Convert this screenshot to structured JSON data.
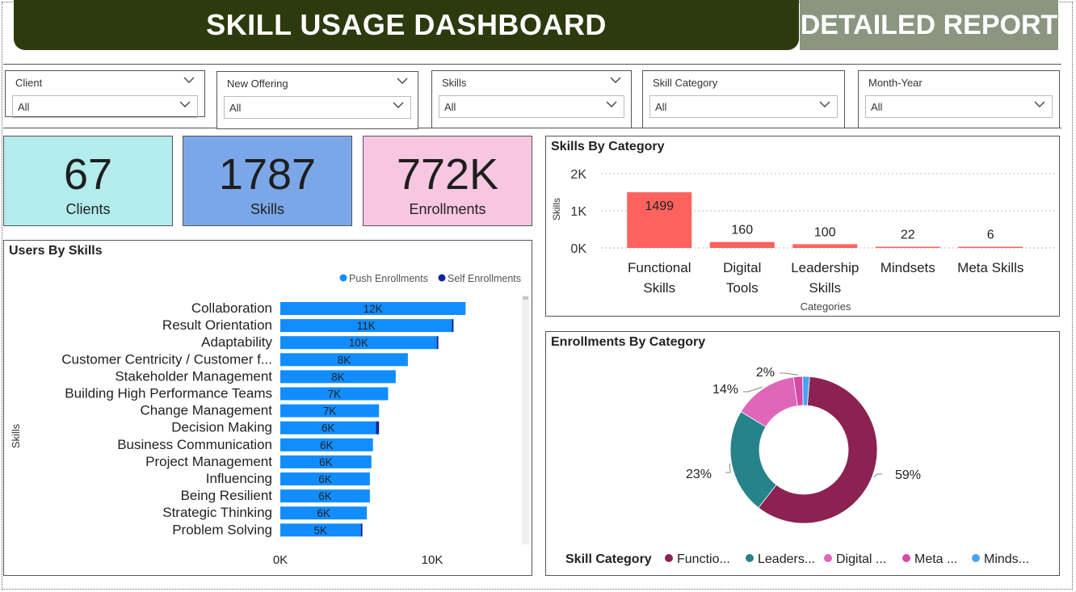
{
  "header": {
    "title": "SKILL USAGE DASHBOARD",
    "report_button": "DETAILED REPORT"
  },
  "filters": [
    {
      "label": "Client",
      "value": "All"
    },
    {
      "label": "New Offering",
      "value": "All"
    },
    {
      "label": "Skills",
      "value": "All"
    },
    {
      "label": "Skill Category",
      "value": "All"
    },
    {
      "label": "Month-Year",
      "value": "All"
    }
  ],
  "kpis": [
    {
      "value": "67",
      "caption": "Clients",
      "color": "#b3ecec"
    },
    {
      "value": "1787",
      "caption": "Skills",
      "color": "#7ba7e8"
    },
    {
      "value": "772K",
      "caption": "Enrollments",
      "color": "#f7c6e0"
    }
  ],
  "colors": {
    "title_bg": "#2d3a0e",
    "report_bg": "#8c9580",
    "push": "#118dff",
    "self": "#12239e",
    "category_bar": "#fd625e"
  },
  "chart_data": [
    {
      "type": "bar",
      "orientation": "horizontal",
      "title": "Users By Skills",
      "ylabel": "Skills",
      "legend": "top-right",
      "series": [
        {
          "name": "Push Enrollments",
          "values": [
            12200,
            11300,
            10300,
            8400,
            7600,
            7100,
            6500,
            6300,
            6100,
            6000,
            5900,
            5900,
            5700,
            5300
          ]
        },
        {
          "name": "Self Enrollments",
          "values": [
            0,
            100,
            100,
            0,
            0,
            0,
            0,
            200,
            0,
            0,
            0,
            0,
            0,
            100
          ]
        }
      ],
      "categories": [
        "Collaboration",
        "Result Orientation",
        "Adaptability",
        "Customer Centricity / Customer f...",
        "Stakeholder Management",
        "Building High Performance Teams",
        "Change Management",
        "Decision Making",
        "Business Communication",
        "Project Management",
        "Influencing",
        "Being Resilient",
        "Strategic Thinking",
        "Problem Solving"
      ],
      "data_labels": [
        "12K",
        "11K",
        "10K",
        "8K",
        "8K",
        "7K",
        "7K",
        "6K",
        "6K",
        "6K",
        "6K",
        "6K",
        "6K",
        "5K"
      ],
      "xticks": [
        {
          "value": 0,
          "label": "0K"
        },
        {
          "value": 10000,
          "label": "10K"
        }
      ],
      "xlim": [
        0,
        15000
      ]
    },
    {
      "type": "bar",
      "title": "Skills By Category",
      "xlabel": "Categories",
      "ylabel": "Skills",
      "categories": [
        [
          "Functional",
          "Skills"
        ],
        [
          "Digital",
          "Tools"
        ],
        [
          "Leadership",
          "Skills"
        ],
        [
          "Mindsets"
        ],
        [
          "Meta Skills"
        ]
      ],
      "values": [
        1499,
        160,
        100,
        22,
        6
      ],
      "yticks": [
        {
          "value": 2000,
          "label": "2K"
        },
        {
          "value": 1000,
          "label": "1K"
        },
        {
          "value": 0,
          "label": "0K"
        }
      ],
      "ylim": [
        0,
        2000
      ]
    },
    {
      "type": "pie",
      "variant": "donut",
      "title": "Enrollments By Category",
      "legend_title": "Skill Category",
      "legend": "bottom",
      "slices": [
        {
          "legend": "Functio...",
          "value": 59,
          "label": "59%",
          "color": "#8b2252"
        },
        {
          "legend": "Leaders...",
          "value": 23,
          "label": "23%",
          "color": "#258389"
        },
        {
          "legend": "Digital ...",
          "value": 14,
          "label": "14%",
          "color": "#e066b9"
        },
        {
          "legend": "Meta ...",
          "value": 2,
          "label": "2%",
          "color": "#d44aa9"
        },
        {
          "legend": "Minds...",
          "value": 1.5,
          "label": "",
          "color": "#4aa3f0"
        }
      ]
    }
  ]
}
